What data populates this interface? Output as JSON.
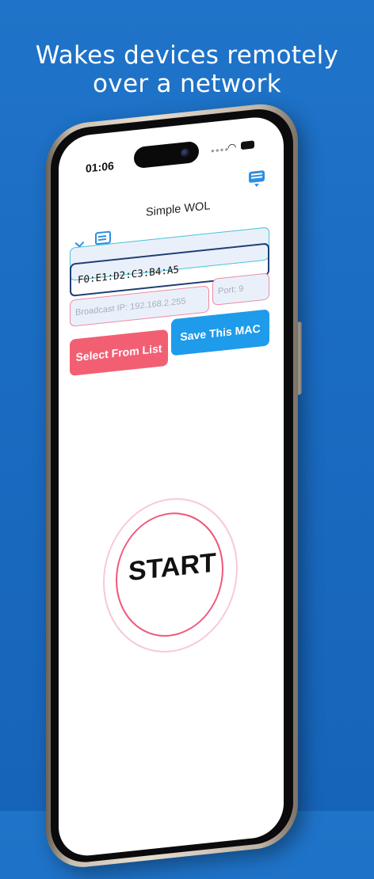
{
  "headline": {
    "line1": "Wakes devices remotely",
    "line2": "over a network"
  },
  "status_bar": {
    "time": "01:06",
    "wifi_icon": "wifi-icon",
    "battery_icon": "battery-icon"
  },
  "app": {
    "title": "Simple WOL",
    "keyboard_icon": "keyboard-icon",
    "tools_icon": "tools-icon",
    "chat_icon": "chat-icon"
  },
  "form": {
    "mac_value": "F0:E1:D2:C3:B4:A5",
    "broadcast_placeholder": "Broadcast IP: 192.168.2.255",
    "port_placeholder": "Port: 9"
  },
  "buttons": {
    "select_from_list": "Select From List",
    "save_this_mac": "Save This MAC",
    "start": "START"
  },
  "colors": {
    "background": "#1a6bc2",
    "accent_blue": "#1e9bea",
    "accent_red": "#f25f73",
    "mac_border": "#1f3f74",
    "top_field_border": "#48c2d8",
    "pink_border": "#f08aa3",
    "start_ring": "#f0587b"
  }
}
